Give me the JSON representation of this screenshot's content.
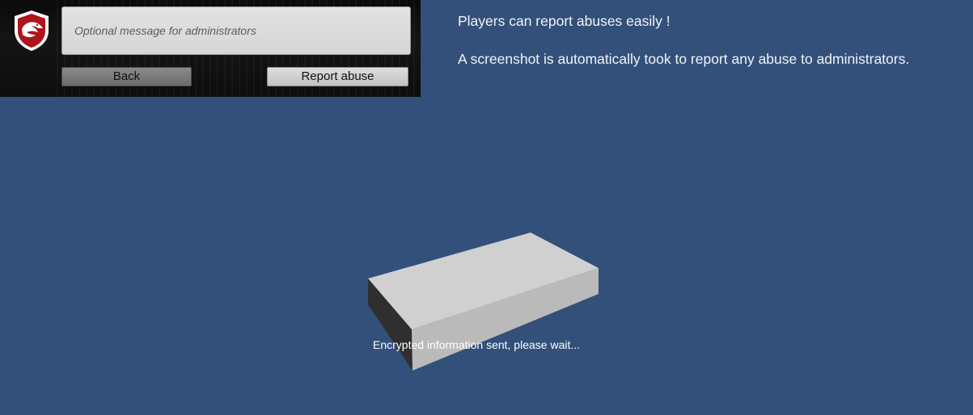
{
  "report_panel": {
    "logo": {
      "icon": "eagle-shield-icon",
      "colors": {
        "outer": "#ffffff",
        "inner": "#b0141c"
      }
    },
    "message_input": {
      "placeholder": "Optional message for administrators",
      "value": ""
    },
    "back_button_label": "Back",
    "report_button_label": "Report abuse"
  },
  "info": {
    "line1": "Players can report abuses easily !",
    "line2": "A screenshot is automatically took to report any abuse to administrators."
  },
  "scene": {
    "background_color": "#325079",
    "object": "grey-box",
    "status_text": "Encrypted information sent, please wait..."
  }
}
